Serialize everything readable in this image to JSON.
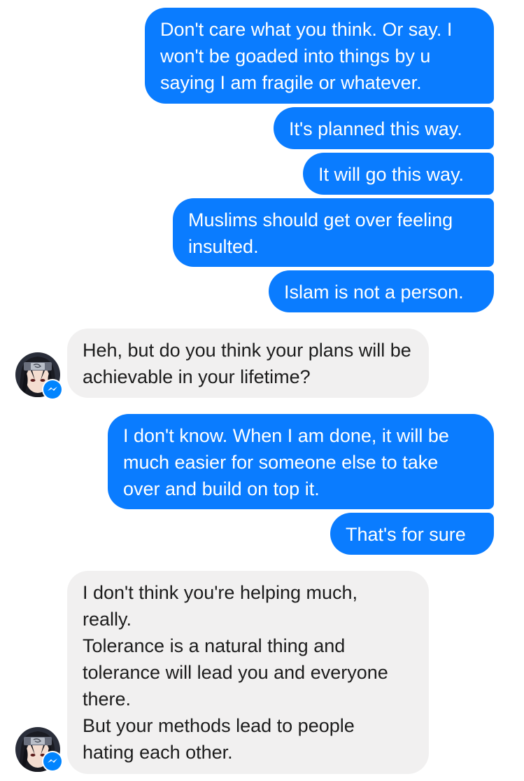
{
  "conversation": {
    "outgoing_1": [
      "Don't care what you think. Or say. I won't be goaded into things by u saying I am fragile or whatever.",
      "It's planned this way.",
      "It will go this way.",
      "Muslims should get over feeling insulted.",
      "Islam is not a person."
    ],
    "incoming_1": "Heh, but do you think your plans will be achievable in your lifetime?",
    "outgoing_2": [
      "I don't know. When I am done, it will be much easier for someone else to take over and build on top it.",
      "That's for sure"
    ],
    "incoming_2": "I don't think you're helping much,\nreally.\nTolerance is a natural thing and\ntolerance will lead you and everyone\nthere.\nBut your methods lead to people\nhating each other."
  },
  "avatar": {
    "icon": "ninja-headband-avatar",
    "badge_icon": "messenger-icon"
  },
  "colors": {
    "outgoing_bubble": "#0a7cff",
    "incoming_bubble": "#f1f0f0",
    "badge": "#0084ff"
  }
}
